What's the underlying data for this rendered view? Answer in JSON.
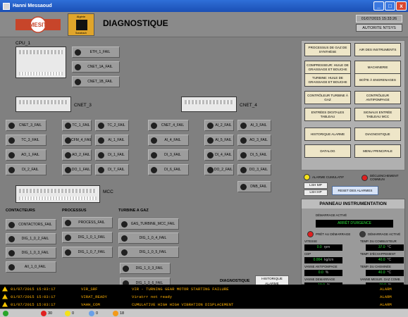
{
  "window": {
    "title": "Hanni Messaoud",
    "buttons": [
      "_",
      "□",
      "x"
    ]
  },
  "header": {
    "logo_text": "MESIT",
    "logo2_top": "Algérie",
    "logo2_bottom": "Sonatrach",
    "title": "DIAGNOSTIQUE",
    "datetime": "01/07/2015 15:33:26",
    "authority": "AUTORITE NTSYS"
  },
  "labels": {
    "cpu": "CPU_1",
    "cnet3": "CNET_3",
    "cnet4": "CNET_4",
    "mcc": "MCC",
    "contacteurs": "CONTACTEURS",
    "process": "PROCESSUS",
    "turbine": "TURBINE A GAZ",
    "diagnostique": "DIAGNOSTIQUE"
  },
  "cpu_indicators": [
    "ETH_1_FAIL",
    "CNET_1A_FAIL",
    "CNET_1B_FAIL"
  ],
  "grid_indicators": [
    [
      "CNET_3_FAIL",
      "TC_1_FAIL",
      "TC_2_FAIL",
      "CNET_4_FAIL",
      "AI_2_FAIL",
      "AI_3_FAIL"
    ],
    [
      "TC_3_FAIL",
      "CFM_4_FAIL",
      "AI_1_FAIL",
      "AI_4_FAIL",
      "AI_5_FAIL",
      "AO_3_FAIL"
    ],
    [
      "AO_1_FAIL",
      "AO_2_FAIL",
      "DI_1_FAIL",
      "DI_3_FAIL",
      "DI_4_FAIL",
      "DI_5_FAIL"
    ],
    [
      "DI_2_FAIL",
      "DO_1_FAIL",
      "DI_7_FAIL",
      "DI_6_FAIL",
      "DO_2_FAIL",
      "DO_3_FAIL"
    ]
  ],
  "dnb_indicator": "DNB_FAIL",
  "contacteurs": [
    "CONTACTORS_FAIL",
    "DIG_1_0_2_FAIL",
    "DIG_1_0_3_FAIL",
    "AII_1_0_FAIL"
  ],
  "process": [
    "PROCESS_FAIL",
    "DIG_1_0_1_FAIL",
    "DIG_1_0_7_FAIL"
  ],
  "turbine": [
    "GAS_TURBINE_MCC_FAIL",
    "DIG_1_0_4_FAIL",
    "DIG_1_0_5_FAIL",
    "DIG_1_0_3_FAIL",
    "DIG_1_0_6_FAIL"
  ],
  "historique_alarme_btn": "HISTORIQUE ALARME",
  "nav_buttons": [
    "PROCESSUS DE GAZ DE SYNTHÈSE",
    "AIR DES INSTRUMENTS",
    "COMPRESSEUR: HUILE DE GRAISSAGE ET BOUCHE",
    "MACHINERIE",
    "TURBINE: HUILE DE GRAISSAGE ET BOUCHE",
    "BOÎTE À ENGRENAGES",
    "CONTRÔLEUR TURBINE À GAZ",
    "CONTRÔLEUR ANTIPOMPAGE",
    "ENTRÉES DIGITALES TABLEAU",
    "SIGNAUX ENTRÉE TABLEAU MCC",
    "HISTORIQUE ALARME",
    "DIAGNOSTIQUE",
    "DATALOG",
    "MENU PRINCIPALE"
  ],
  "legend": {
    "alarme_cumulatif": "ALARME CUMULATIF",
    "declenchement": "DÉCLENCHEMENT COMMUN",
    "lsh_mp": "LSH MP",
    "lsh_hp": "LSH HP",
    "reset": "RESET DES ALARMES",
    "colors": {
      "alarm": "#f5e21a",
      "trip": "#e02020"
    }
  },
  "instrumentation": {
    "title": "PANNEAU INSTRUMENTATION",
    "demarrage_label": "DÉMARRAGE ACTIVÉ",
    "urgence": "ARRÊT D'URGENCE",
    "pret": "PRÊT AU DÉMARRAGE",
    "demarrage_active": "DÉMARRAGE ACTIVÉ",
    "fields": [
      {
        "label": "VITESSE",
        "value": "0.0",
        "unit": "rpm"
      },
      {
        "label": "TEMP. DU COMBUSTEUR",
        "value": "37.0",
        "unit": "°C"
      },
      {
        "label": "CDP",
        "value": "0.004",
        "unit": "kg/cm"
      },
      {
        "label": "TEMP. D'ÉCHAPPEMENT",
        "value": "40.0",
        "unit": "°C"
      },
      {
        "label": "VANNE ANTIPOMPAGE",
        "value": "0.0",
        "unit": "%"
      },
      {
        "label": "TEMP. DU CHEMINÉE",
        "value": "40.0",
        "unit": "°C"
      },
      {
        "label": "VANNE DEMARRAGE",
        "value": "-10.0",
        "unit": "%"
      },
      {
        "label": "VANNE MESUR. GAZ COMB.",
        "value": "-10.0",
        "unit": "%"
      }
    ]
  },
  "alarms": [
    {
      "time": "01/07/2015 15:03:17",
      "tag": "VIR_SRF",
      "desc": "VIR - TURNING GEAR MOTOR STARTING FAILURE",
      "type": "ALARM"
    },
    {
      "time": "01/07/2015 15:03:17",
      "tag": "VIRAT_READY",
      "desc": "Viratrr not ready",
      "type": "ALARM"
    },
    {
      "time": "01/07/2015 15:03:17",
      "tag": "VAHH_COM",
      "desc": "CUMULATIVE HIGH HIGH VIBRATION DISPLACEMENT",
      "type": "ALARM"
    }
  ],
  "status": {
    "count1": "30",
    "count2": "0",
    "count3": "0",
    "count4": "18"
  }
}
